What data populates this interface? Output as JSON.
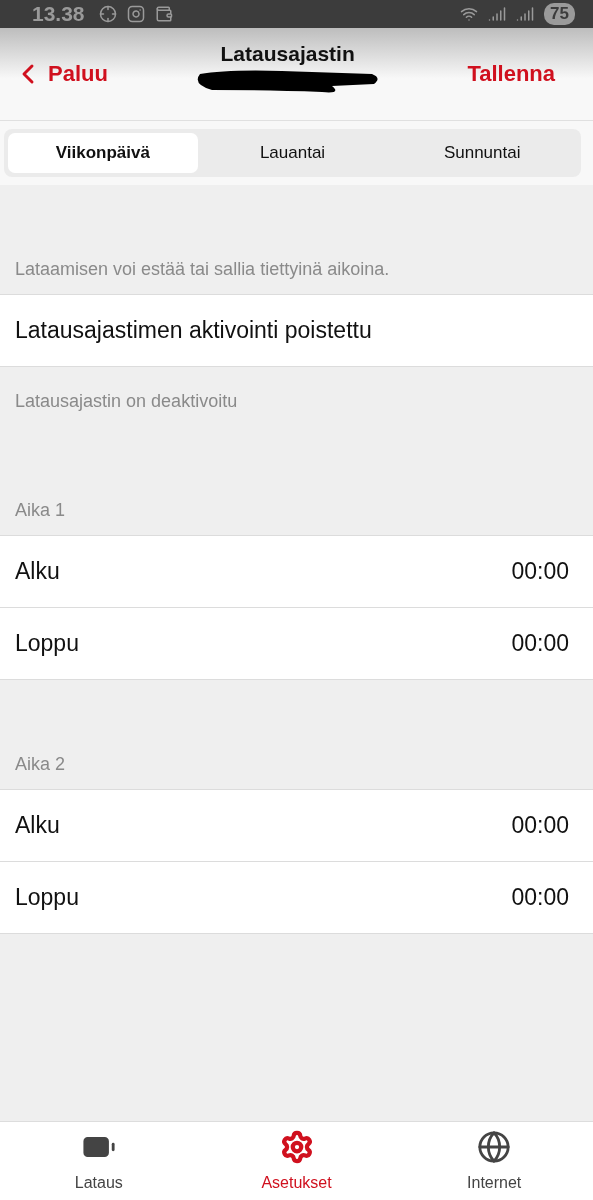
{
  "status_bar": {
    "time": "13.38",
    "battery": "75"
  },
  "header": {
    "back": "Paluu",
    "title": "Latausajastin",
    "save": "Tallenna"
  },
  "tabs": [
    {
      "label": "Viikonpäivä",
      "selected": true
    },
    {
      "label": "Lauantai",
      "selected": false
    },
    {
      "label": "Sunnuntai",
      "selected": false
    }
  ],
  "intro": "Lataamisen voi estää tai sallia tiettyinä aikoina.",
  "activation": {
    "label": "Latausajastimen aktivointi poistettu",
    "note": "Latausajastin on deaktivoitu"
  },
  "periods": [
    {
      "title": "Aika 1",
      "rows": [
        {
          "label": "Alku",
          "value": "00:00"
        },
        {
          "label": "Loppu",
          "value": "00:00"
        }
      ]
    },
    {
      "title": "Aika 2",
      "rows": [
        {
          "label": "Alku",
          "value": "00:00"
        },
        {
          "label": "Loppu",
          "value": "00:00"
        }
      ]
    }
  ],
  "nav": [
    {
      "kind": "battery",
      "label": "Lataus",
      "selected": false
    },
    {
      "kind": "gear",
      "label": "Asetukset",
      "selected": true
    },
    {
      "kind": "globe",
      "label": "Internet",
      "selected": false
    }
  ]
}
